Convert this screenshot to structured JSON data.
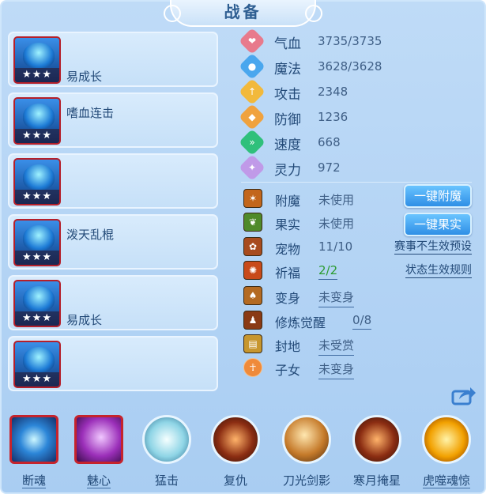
{
  "title": "战备",
  "slots": [
    {
      "stars": "★★★",
      "label": "易成长",
      "icon": "warrior-sprite-icon"
    },
    {
      "stars": "★★★",
      "label": "嗜血连击",
      "icon": "dragon-sprite-icon"
    },
    {
      "stars": "★★★",
      "label": "",
      "icon": "armored-sprite-icon"
    },
    {
      "stars": "★★★",
      "label": "泼天乱棍",
      "icon": "beast-sprite-icon"
    },
    {
      "stars": "★★★",
      "label": "易成长",
      "icon": "spirit-sprite-icon"
    },
    {
      "stars": "★★★",
      "label": "",
      "icon": "crown-sprite-icon"
    }
  ],
  "stats": [
    {
      "name": "气血",
      "value": "3735/3735",
      "icon": "heart-icon",
      "color": "#e87a8c"
    },
    {
      "name": "魔法",
      "value": "3628/3628",
      "icon": "magic-icon",
      "color": "#4aa7ee"
    },
    {
      "name": "攻击",
      "value": "2348",
      "icon": "attack-icon",
      "color": "#f2b93b"
    },
    {
      "name": "防御",
      "value": "1236",
      "icon": "defense-icon",
      "color": "#f0a23e"
    },
    {
      "name": "速度",
      "value": "668",
      "icon": "speed-icon",
      "color": "#2fc07b"
    },
    {
      "name": "灵力",
      "value": "972",
      "icon": "spirit-power-icon",
      "color": "#c09ae8"
    }
  ],
  "extras": [
    {
      "name": "附魔",
      "value": "未使用",
      "icon": "enchant-icon",
      "underline": false
    },
    {
      "name": "果实",
      "value": "未使用",
      "icon": "fruit-icon",
      "underline": false
    },
    {
      "name": "宠物",
      "value": "11/10",
      "icon": "pet-icon",
      "underline": false
    },
    {
      "name": "祈福",
      "value": "2/2",
      "icon": "blessing-icon",
      "underline": true
    },
    {
      "name": "变身",
      "value": "未变身",
      "icon": "transform-icon",
      "underline": true
    },
    {
      "name": "修炼觉醒",
      "value": "0/8",
      "icon": "cultivation-icon",
      "underline": true
    },
    {
      "name": "封地",
      "value": "未受赏",
      "icon": "fief-icon",
      "underline": true
    },
    {
      "name": "子女",
      "value": "未变身",
      "icon": "children-icon",
      "underline": true
    }
  ],
  "buttons": {
    "enchant": "一键附魔",
    "fruit": "一键果实"
  },
  "links": {
    "preset": "赛事不生效预设",
    "rules": "状态生效规则"
  },
  "skills": [
    {
      "label": "断魂",
      "icon": "soul-break-icon"
    },
    {
      "label": "魅心",
      "icon": "charm-icon"
    },
    {
      "label": "猛击",
      "icon": "smash-icon"
    },
    {
      "label": "复仇",
      "icon": "revenge-icon"
    },
    {
      "label": "刀光剑影",
      "icon": "blade-shadow-icon"
    },
    {
      "label": "寒月掩星",
      "icon": "cold-moon-icon"
    },
    {
      "label": "虎噬魂惊",
      "icon": "tiger-soul-icon"
    }
  ],
  "colors": {
    "accent": "#2f8fe6",
    "text": "#234a78",
    "star_bg": "#b51f2a",
    "green": "#2b9b2f"
  }
}
